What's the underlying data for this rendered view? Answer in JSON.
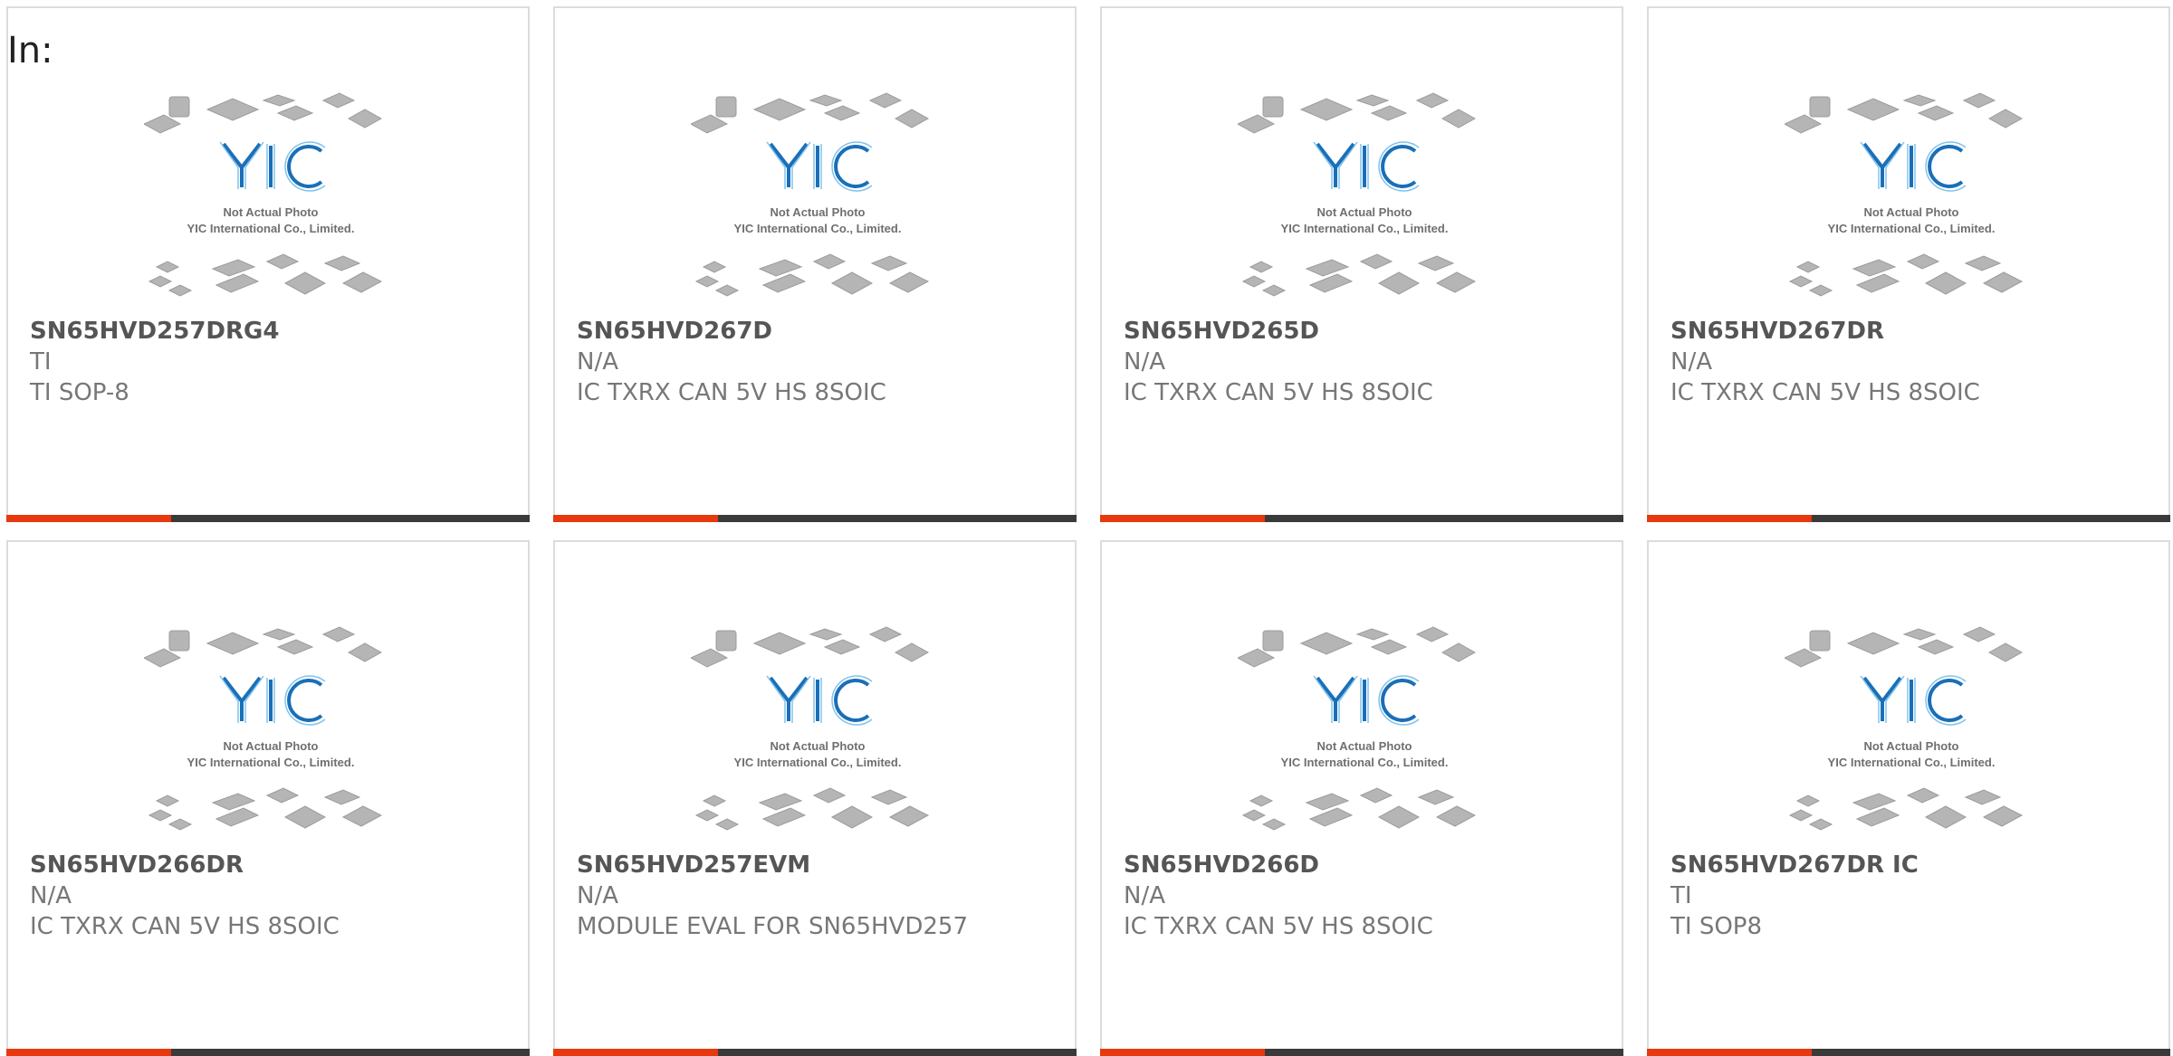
{
  "heading": "In:",
  "thumbnail": {
    "logo": "YIC",
    "caption_line1": "Not Actual Photo",
    "caption_line2": "YIC International Co., Limited."
  },
  "colors": {
    "accent": "#e8380d",
    "bar": "#3a3a3a",
    "logo_blue": "#1a6fb8",
    "chip_gray": "#b5b5b5"
  },
  "products": [
    {
      "part_number": "SN65HVD257DRG4",
      "manufacturer": "TI",
      "description": "TI SOP-8"
    },
    {
      "part_number": "SN65HVD267D",
      "manufacturer": "N/A",
      "description": "IC TXRX CAN 5V HS 8SOIC"
    },
    {
      "part_number": "SN65HVD265D",
      "manufacturer": "N/A",
      "description": "IC TXRX CAN 5V HS 8SOIC"
    },
    {
      "part_number": "SN65HVD267DR",
      "manufacturer": "N/A",
      "description": "IC TXRX CAN 5V HS 8SOIC"
    },
    {
      "part_number": "SN65HVD266DR",
      "manufacturer": "N/A",
      "description": "IC TXRX CAN 5V HS 8SOIC"
    },
    {
      "part_number": "SN65HVD257EVM",
      "manufacturer": "N/A",
      "description": "MODULE EVAL FOR SN65HVD257"
    },
    {
      "part_number": "SN65HVD266D",
      "manufacturer": "N/A",
      "description": "IC TXRX CAN 5V HS 8SOIC"
    },
    {
      "part_number": "SN65HVD267DR IC",
      "manufacturer": "TI",
      "description": "TI SOP8"
    }
  ]
}
